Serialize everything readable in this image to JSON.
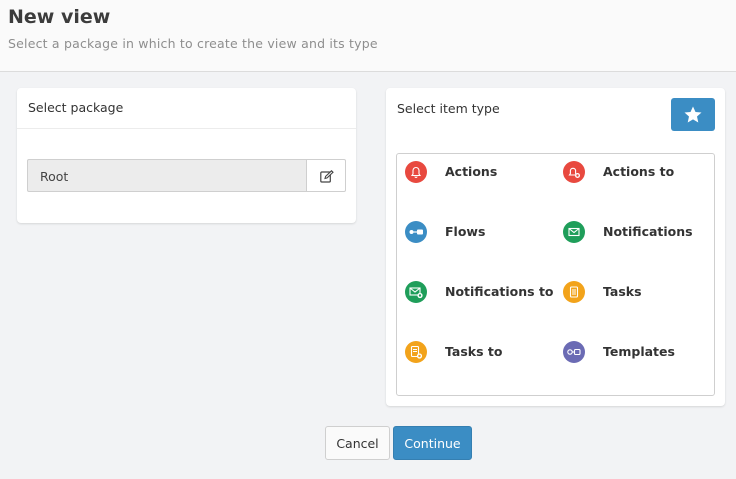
{
  "header": {
    "title": "New view",
    "subtitle": "Select a package in which to create the view and its type"
  },
  "package_panel": {
    "heading": "Select package",
    "selected_package": "Root",
    "edit_icon": "edit-icon"
  },
  "type_panel": {
    "heading": "Select item type",
    "favorite_icon": "star-icon",
    "items": [
      {
        "label": "Actions",
        "icon": "bell-icon",
        "color": "#e8493f"
      },
      {
        "label": "Actions to",
        "icon": "bell-plus-icon",
        "color": "#e8493f"
      },
      {
        "label": "Flows",
        "icon": "flow-icon",
        "color": "#3b8dc4"
      },
      {
        "label": "Notifications",
        "icon": "envelope-icon",
        "color": "#1f9e5a"
      },
      {
        "label": "Notifications to",
        "icon": "envelope-plus-icon",
        "color": "#1f9e5a"
      },
      {
        "label": "Tasks",
        "icon": "clipboard-icon",
        "color": "#f2a31b"
      },
      {
        "label": "Tasks to",
        "icon": "clipboard-plus-icon",
        "color": "#f2a31b"
      },
      {
        "label": "Templates",
        "icon": "template-icon",
        "color": "#6b6bb4"
      }
    ]
  },
  "footer": {
    "cancel_label": "Cancel",
    "continue_label": "Continue"
  },
  "colors": {
    "accent": "#3b8dc4"
  }
}
